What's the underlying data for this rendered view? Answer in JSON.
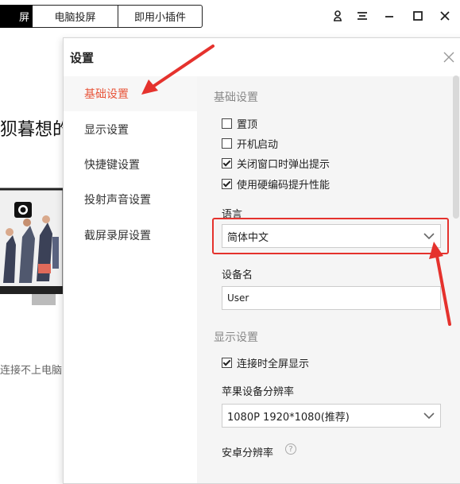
{
  "topbar": {
    "tabs": [
      {
        "label": "屏",
        "active": true
      },
      {
        "label": "电脑投屏",
        "active": false
      },
      {
        "label": "即用小插件",
        "active": false
      }
    ],
    "icons": [
      "user-icon",
      "menu-icon",
      "minimize-icon",
      "maximize-icon",
      "close-icon"
    ]
  },
  "background": {
    "headline": "狈暮想的屏",
    "note": "连接不上电脑"
  },
  "dialog": {
    "title": "设置",
    "nav": [
      {
        "label": "基础设置",
        "active": true
      },
      {
        "label": "显示设置",
        "active": false
      },
      {
        "label": "快捷键设置",
        "active": false
      },
      {
        "label": "投射声音设置",
        "active": false
      },
      {
        "label": "截屏录屏设置",
        "active": false
      }
    ],
    "basic": {
      "title": "基础设置",
      "checkboxes": [
        {
          "label": "置顶",
          "checked": false
        },
        {
          "label": "开机启动",
          "checked": false
        },
        {
          "label": "关闭窗口时弹出提示",
          "checked": true
        },
        {
          "label": "使用硬编码提升性能",
          "checked": true
        }
      ],
      "language_label": "语言",
      "language_value": "简体中文",
      "device_label": "设备名",
      "device_value": "User"
    },
    "display": {
      "title": "显示设置",
      "fullscreen_label": "连接时全屏显示",
      "fullscreen_checked": true,
      "apple_res_label": "苹果设备分辨率",
      "apple_res_value": "1080P 1920*1080(推荐)",
      "android_res_label": "安卓分辨率",
      "help_glyph": "?"
    }
  },
  "colors": {
    "accent": "#e8553a",
    "annotation_red": "#e5322d"
  }
}
